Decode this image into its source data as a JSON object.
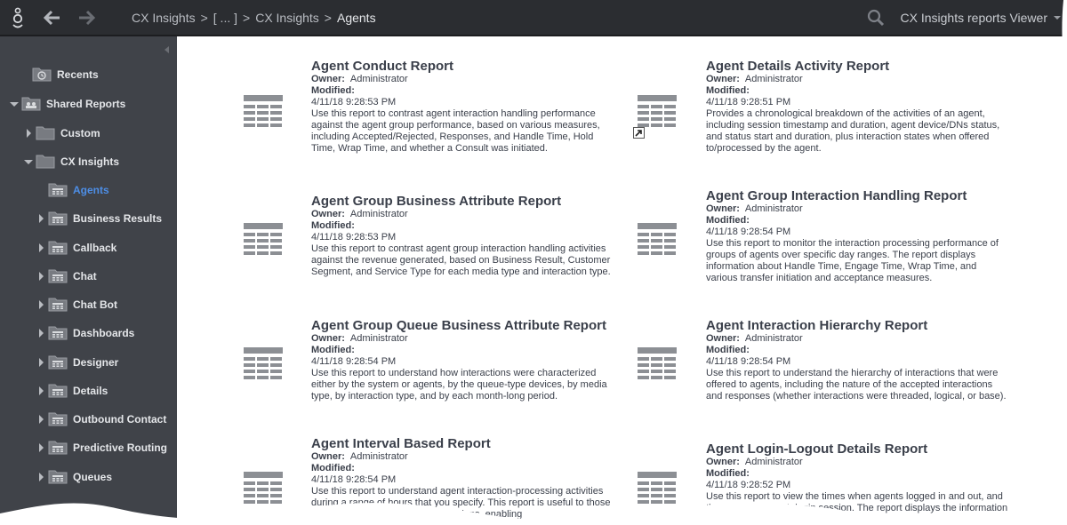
{
  "topbar": {
    "breadcrumb": [
      "CX Insights",
      ">",
      "[ ... ]",
      ">",
      "CX Insights",
      ">"
    ],
    "current": "Agents",
    "user": "CX Insights reports Viewer"
  },
  "sidebar": {
    "items": [
      {
        "label": "Recents"
      },
      {
        "label": "Shared Reports"
      },
      {
        "label": "Custom"
      },
      {
        "label": "CX Insights"
      },
      {
        "label": "Agents"
      },
      {
        "label": "Business Results"
      },
      {
        "label": "Callback"
      },
      {
        "label": "Chat"
      },
      {
        "label": "Chat Bot"
      },
      {
        "label": "Dashboards"
      },
      {
        "label": "Designer"
      },
      {
        "label": "Details"
      },
      {
        "label": "Outbound Contact"
      },
      {
        "label": "Predictive Routing"
      },
      {
        "label": "Queues"
      }
    ]
  },
  "labels": {
    "owner": "Owner:",
    "modified": "Modified:"
  },
  "reports": [
    {
      "title": "Agent Conduct Report",
      "owner": "Administrator",
      "modified": "4/11/18 9:28:53 PM",
      "desc": "Use this report to contrast agent interaction handling performance against the agent group performance, based on various measures, including Accepted/Rejected, Responses, and Handle Time, Hold Time, Wrap Time, and whether a Consult was initiated."
    },
    {
      "title": "Agent Details Activity Report",
      "owner": "Administrator",
      "modified": "4/11/18 9:28:51 PM",
      "desc": "Provides a chronological breakdown of the activities of an agent, including session timestamp and duration, agent device/DNs status, and status start and duration, plus interaction states when offered to/processed by the agent."
    },
    {
      "title": "Agent Group Business Attribute Report",
      "owner": "Administrator",
      "modified": "4/11/18 9:28:53 PM",
      "desc": "Use this report to contrast agent group interaction handling activities against the revenue generated, based on Business Result, Customer Segment, and Service Type for each media type and interaction type."
    },
    {
      "title": "Agent Group Interaction Handling Report",
      "owner": "Administrator",
      "modified": "4/11/18 9:28:54 PM",
      "desc": "Use this report to monitor the interaction processing performance of groups of agents over specific day ranges. The report displays information about Handle Time, Engage Time, Wrap Time, and various transfer initiation and acceptance measures."
    },
    {
      "title": "Agent Group Queue Business Attribute Report",
      "owner": "Administrator",
      "modified": "4/11/18 9:28:54 PM",
      "desc": "Use this report to understand how interactions were characterized either by the system or agents, by the queue-type devices, by media type, by interaction type, and by each month-long period."
    },
    {
      "title": "Agent Interaction Hierarchy Report",
      "owner": "Administrator",
      "modified": "4/11/18 9:28:54 PM",
      "desc": "Use this report to understand the hierarchy of interactions that were offered to agents, including the nature of the accepted interactions and responses (whether interactions were threaded, logical, or base)."
    },
    {
      "title": "Agent Interval Based Report",
      "owner": "Administrator",
      "modified": "4/11/18 9:28:54 PM",
      "desc": "Use this report to understand agent interaction-processing activities during a range of hours that you specify. This report is useful to those who manage contact center operations, enabling"
    },
    {
      "title": "Agent Login-Logout Details Report",
      "owner": "Administrator",
      "modified": "4/11/18 9:28:52 PM",
      "desc": "Use this report to view the times when agents logged in and out, and the duration of each login session. The report displays the information in standard time zone."
    }
  ],
  "colors": {
    "topbar": "#2b2d31",
    "sidebar": "#404349",
    "selected": "#4d8ee6",
    "text": "#3a3f4a"
  }
}
